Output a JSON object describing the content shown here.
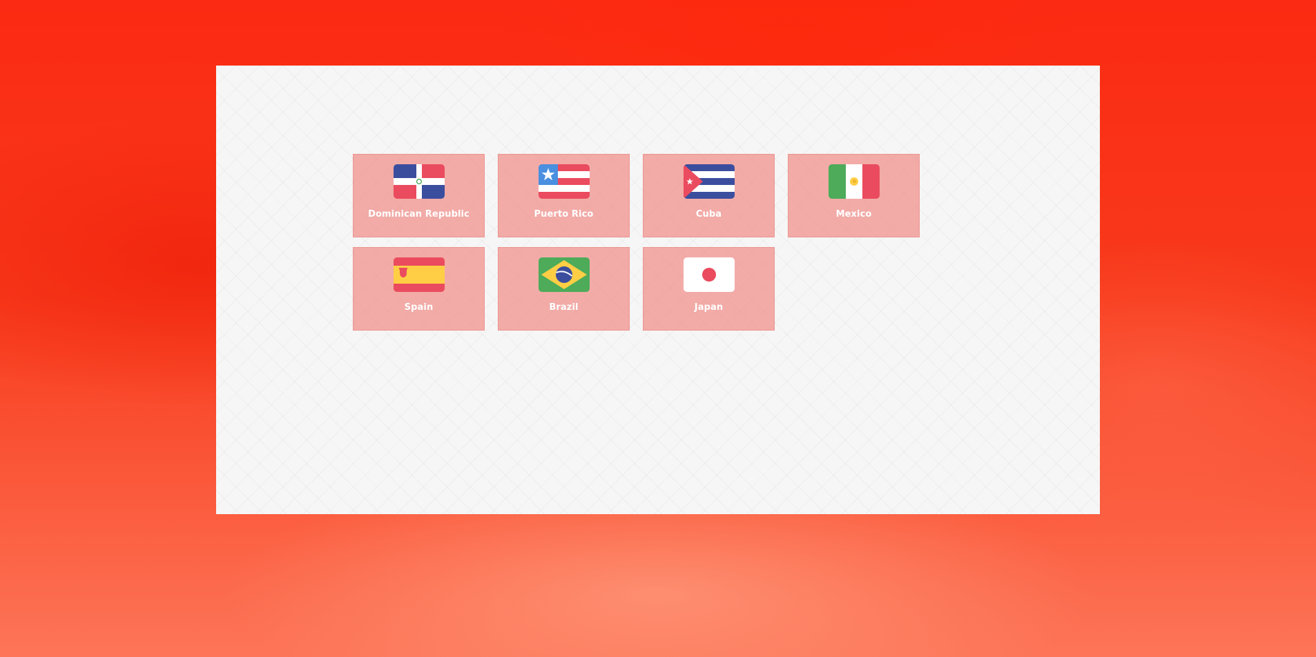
{
  "countries": [
    {
      "name": "Dominican Republic",
      "flag_icon": "dominican-republic-flag-icon"
    },
    {
      "name": "Puerto Rico",
      "flag_icon": "puerto-rico-flag-icon"
    },
    {
      "name": "Cuba",
      "flag_icon": "cuba-flag-icon"
    },
    {
      "name": "Mexico",
      "flag_icon": "mexico-flag-icon"
    },
    {
      "name": "Spain",
      "flag_icon": "spain-flag-icon"
    },
    {
      "name": "Brazil",
      "flag_icon": "brazil-flag-icon"
    },
    {
      "name": "Japan",
      "flag_icon": "japan-flag-icon"
    }
  ],
  "colors": {
    "background": "#fb2a12",
    "panel": "#f6f6f6",
    "card": "#f08782",
    "flag_blue": "#3b4e9e",
    "flag_red": "#ea4b5e",
    "flag_green": "#4dab5a",
    "flag_yellow": "#ffce45",
    "flag_white": "#ffffff"
  }
}
